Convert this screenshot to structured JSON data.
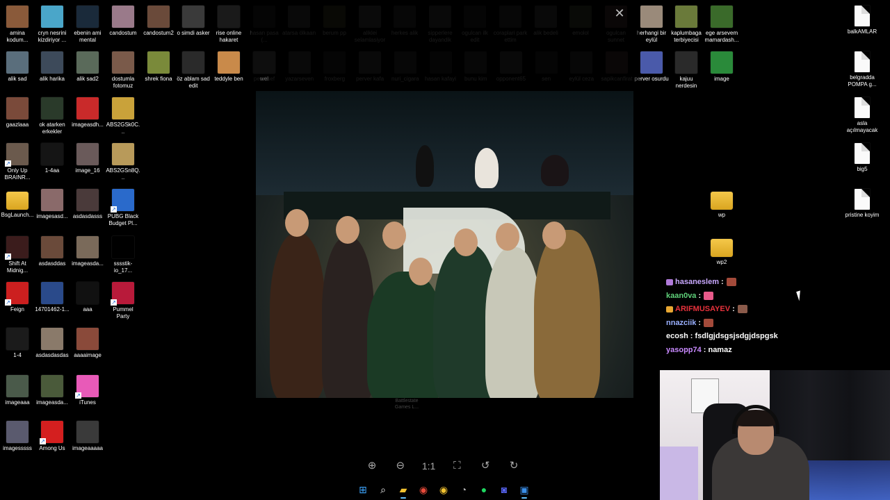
{
  "desktop": {
    "icons_col1": [
      {
        "label": "amina kodum...",
        "kind": "thumb",
        "color": "#8a5a3a"
      },
      {
        "label": "alik sad",
        "kind": "thumb",
        "color": "#5a6e7c"
      },
      {
        "label": "gaazlaaa",
        "kind": "thumb",
        "color": "#7a4a3a"
      },
      {
        "label": "Only Up BRAINR...",
        "kind": "thumb",
        "color": "#6b5a4d",
        "shortcut": true
      },
      {
        "label": "BsgLaunch...",
        "kind": "folder",
        "color": "#e8b73a"
      },
      {
        "label": "Shift At Midnig...",
        "kind": "thumb",
        "color": "#3b1c1c",
        "shortcut": true
      },
      {
        "label": "Feign",
        "kind": "thumb",
        "color": "#cc1f1f",
        "shortcut": true
      },
      {
        "label": "1-4",
        "kind": "thumb",
        "color": "#1b1b1b"
      },
      {
        "label": "imageaaa",
        "kind": "thumb",
        "color": "#4a5a4a"
      },
      {
        "label": "imagesssss",
        "kind": "thumb",
        "color": "#5a5a6e"
      }
    ],
    "icons_col2": [
      {
        "label": "cryn nesrini kizdiriyor ...",
        "kind": "thumb",
        "color": "#4aa6c9"
      },
      {
        "label": "alik harika",
        "kind": "thumb",
        "color": "#3d4a5a"
      },
      {
        "label": "ok atarken erkekler",
        "kind": "thumb",
        "color": "#2a3a2a"
      },
      {
        "label": "1-4aa",
        "kind": "thumb",
        "color": "#151515"
      },
      {
        "label": "imagesasd...",
        "kind": "thumb",
        "color": "#8a6a6a"
      },
      {
        "label": "asdasddas",
        "kind": "thumb",
        "color": "#6a4a3a"
      },
      {
        "label": "14701462-1...",
        "kind": "thumb",
        "color": "#2a4a8a"
      },
      {
        "label": "asdasdasdas",
        "kind": "thumb",
        "color": "#8a7a6a"
      },
      {
        "label": "imageasda...",
        "kind": "thumb",
        "color": "#4a5a3a"
      },
      {
        "label": "Among Us",
        "kind": "thumb",
        "color": "#d41f1f",
        "shortcut": true
      }
    ],
    "icons_col3": [
      {
        "label": "ebenin ami mental",
        "kind": "thumb",
        "color": "#1a2a3a"
      },
      {
        "label": "alik sad2",
        "kind": "thumb",
        "color": "#5a6a5a"
      },
      {
        "label": "imageasdh...",
        "kind": "thumb",
        "color": "#c92a2a"
      },
      {
        "label": "image_16",
        "kind": "thumb",
        "color": "#6a5a5a"
      },
      {
        "label": "asdasdasss",
        "kind": "thumb",
        "color": "#4a3a3a"
      },
      {
        "label": "imageasda...",
        "kind": "thumb",
        "color": "#7a6a5a"
      },
      {
        "label": "aaa",
        "kind": "thumb",
        "color": "#111111"
      },
      {
        "label": "aaaaimage",
        "kind": "thumb",
        "color": "#8a4a3a"
      },
      {
        "label": "iTunes",
        "kind": "thumb",
        "color": "#e85ab8",
        "shortcut": true
      },
      {
        "label": "imageaaaaa",
        "kind": "thumb",
        "color": "#3a3a3a"
      }
    ],
    "icons_col4": [
      {
        "label": "candostum",
        "kind": "thumb",
        "color": "#9a7a8a"
      },
      {
        "label": "dostumla fotomuz",
        "kind": "thumb",
        "color": "#7a5a4a"
      },
      {
        "label": "ABS2GSk0C...",
        "kind": "thumb",
        "color": "#c9a23a"
      },
      {
        "label": "ABS2GSn8Q...",
        "kind": "thumb",
        "color": "#b89a5a"
      },
      {
        "label": "PUBG Black Budget Pl...",
        "kind": "thumb",
        "color": "#2a6acb",
        "shortcut": true
      },
      {
        "label": "sssstik-io_17...",
        "kind": "thumb",
        "color": "#000000"
      },
      {
        "label": "Pummel Party",
        "kind": "thumb",
        "color": "#b81a3a",
        "shortcut": true
      }
    ],
    "icons_row1_rest": [
      {
        "label": "candostum2",
        "kind": "thumb",
        "color": "#6a4a3a"
      },
      {
        "label": "o simdi asker",
        "kind": "thumb",
        "color": "#3a3a3a"
      },
      {
        "label": "rise online hakaret",
        "kind": "thumb",
        "color": "#1a1a1a"
      },
      {
        "label": "hasan pasa (...",
        "kind": "thumb",
        "color": "#3a3a3a",
        "dim": true
      },
      {
        "label": "atarsa ölkaan",
        "kind": "thumb",
        "color": "#5a5a5a",
        "dim": true
      },
      {
        "label": "berum pp",
        "kind": "thumb",
        "color": "#5a5a3a",
        "dim": true
      },
      {
        "label": "aliklei selamlasiyor",
        "kind": "thumb",
        "color": "#6a6a6a",
        "dim": true
      },
      {
        "label": "herkes alik",
        "kind": "thumb",
        "color": "#4a4a4a",
        "dim": true
      },
      {
        "label": "sipperlere dayandik",
        "kind": "thumb",
        "color": "#5a5a5a",
        "dim": true
      },
      {
        "label": "ogulcan ilk edit",
        "kind": "thumb",
        "color": "#3a3a3a",
        "dim": true
      },
      {
        "label": "coraplari park ettim",
        "kind": "thumb",
        "color": "#4a4a4a",
        "dim": true
      },
      {
        "label": "alik bedeli",
        "kind": "thumb",
        "color": "#5a5a5a",
        "dim": true
      },
      {
        "label": "emolol",
        "kind": "thumb",
        "color": "#5a6a4a",
        "dim": true
      },
      {
        "label": "ogulcan sunnet",
        "kind": "thumb",
        "color": "#6a4a4a",
        "dim": true
      },
      {
        "label": "herhangi bir eylül",
        "kind": "thumb",
        "color": "#9a8a7a"
      },
      {
        "label": "kaplumbaga terbiyecisi",
        "kind": "thumb",
        "color": "#6a7a3a"
      },
      {
        "label": "ege arsevem mamardash...",
        "kind": "thumb",
        "color": "#3a6a2a"
      }
    ],
    "icons_row2_rest": [
      {
        "label": "shrek fiona",
        "kind": "thumb",
        "color": "#7a8a3a"
      },
      {
        "label": "öz ablam sad edit",
        "kind": "thumb",
        "color": "#2a2a2a"
      },
      {
        "label": "teddyle ben",
        "kind": "thumb",
        "color": "#c98a4a"
      },
      {
        "label": "wel",
        "kind": "thumb",
        "color": "#1a1a1a"
      },
      {
        "label": "pen itsef",
        "kind": "thumb",
        "color": "#3a3a3a",
        "dim": true
      },
      {
        "label": "yazarseven",
        "kind": "thumb",
        "color": "#5a5a5a",
        "dim": true
      },
      {
        "label": "froxberg",
        "kind": "thumb",
        "color": "#3a3a3a",
        "dim": true
      },
      {
        "label": "perver kafa",
        "kind": "thumb",
        "color": "#5a5a5a",
        "dim": true
      },
      {
        "label": "nuri_cigara",
        "kind": "thumb",
        "color": "#4a4a4a",
        "dim": true
      },
      {
        "label": "hasan kafayi",
        "kind": "thumb",
        "color": "#3a3a3a",
        "dim": true
      },
      {
        "label": "bunu kim",
        "kind": "thumb",
        "color": "#4a4a4a",
        "dim": true
      },
      {
        "label": "opponent65",
        "kind": "thumb",
        "color": "#5a5a5a",
        "dim": true
      },
      {
        "label": "sen",
        "kind": "thumb",
        "color": "#3a3a3a",
        "dim": true
      },
      {
        "label": "eylül ceza",
        "kind": "thumb",
        "color": "#4a4a4a",
        "dim": true
      },
      {
        "label": "sapikcanfirat",
        "kind": "thumb",
        "color": "#6a4a4a",
        "dim": true
      },
      {
        "label": "perver osurdu",
        "kind": "thumb",
        "color": "#4a5aaa"
      },
      {
        "label": "kajuu nerdesin",
        "kind": "thumb",
        "color": "#2a2a2a"
      },
      {
        "label": "image",
        "kind": "thumb",
        "color": "#2a8a3a"
      }
    ],
    "icons_right": [
      {
        "label": "balkAMLAR",
        "kind": "doc"
      },
      {
        "label": "belgradda POMPA g...",
        "kind": "doc"
      },
      {
        "label": "asla açılmayacak",
        "kind": "doc"
      },
      {
        "label": "big5",
        "kind": "doc"
      },
      {
        "label": "pristine koyim",
        "kind": "doc"
      }
    ],
    "icons_mid_right": [
      {
        "label": "wp",
        "kind": "folder"
      },
      {
        "label": "wp2",
        "kind": "folder"
      }
    ]
  },
  "viewer": {
    "close_icon": "✕",
    "caption": "Battlestate Games L...",
    "toolbar": {
      "zoom_in_icon": "⊕",
      "zoom_out_icon": "⊖",
      "actual_size_label": "1:1",
      "fit_icon": "⛶",
      "rotate_left_icon": "↺",
      "rotate_right_icon": "↻"
    }
  },
  "chat": {
    "messages": [
      {
        "user": "hasaneslem",
        "color": "#c9a8ff",
        "badge_color": "#b07ad9",
        "msg": ":",
        "emote_color": "#a34a3a"
      },
      {
        "user": "kaan0va",
        "color": "#5fd07a",
        "badge_color": "",
        "msg": ":",
        "emote_color": "#e85a8a"
      },
      {
        "user": "ARIFMUSAYEV",
        "color": "#e8323c",
        "badge_color": "#e8a732",
        "msg": ":",
        "emote_color": "#8a5a4a"
      },
      {
        "user": "nnazciik",
        "color": "#9ab0ff",
        "badge_color": "",
        "msg": ":",
        "emote_color": "#a34a3a"
      },
      {
        "user": "ecosh",
        "color": "#ffffff",
        "badge_color": "",
        "msg": ": fsdlgjdsgsjsdgjdspgsk",
        "emote_color": ""
      },
      {
        "user": "yasopp74",
        "color": "#c98aff",
        "badge_color": "",
        "msg": ": namaz",
        "emote_color": ""
      }
    ]
  },
  "taskbar": {
    "icons": [
      {
        "name": "windows-start-icon",
        "glyph": "⊞",
        "color": "#3ea6ff"
      },
      {
        "name": "search-icon",
        "glyph": "⌕",
        "color": "#ffffff"
      },
      {
        "name": "file-explorer-icon",
        "glyph": "▰",
        "color": "#f2c230",
        "active": true
      },
      {
        "name": "chrome-icon",
        "glyph": "◉",
        "color": "#e84a3a"
      },
      {
        "name": "chrome-alt-icon",
        "glyph": "◉",
        "color": "#f2c230"
      },
      {
        "name": "clock-app-icon",
        "glyph": "◔",
        "color": "#aaaaaa"
      },
      {
        "name": "spotify-icon",
        "glyph": "●",
        "color": "#1ed760"
      },
      {
        "name": "discord-icon",
        "glyph": "◙",
        "color": "#5865f2"
      },
      {
        "name": "photos-icon",
        "glyph": "▣",
        "color": "#3a8ee8",
        "active": true
      }
    ]
  }
}
